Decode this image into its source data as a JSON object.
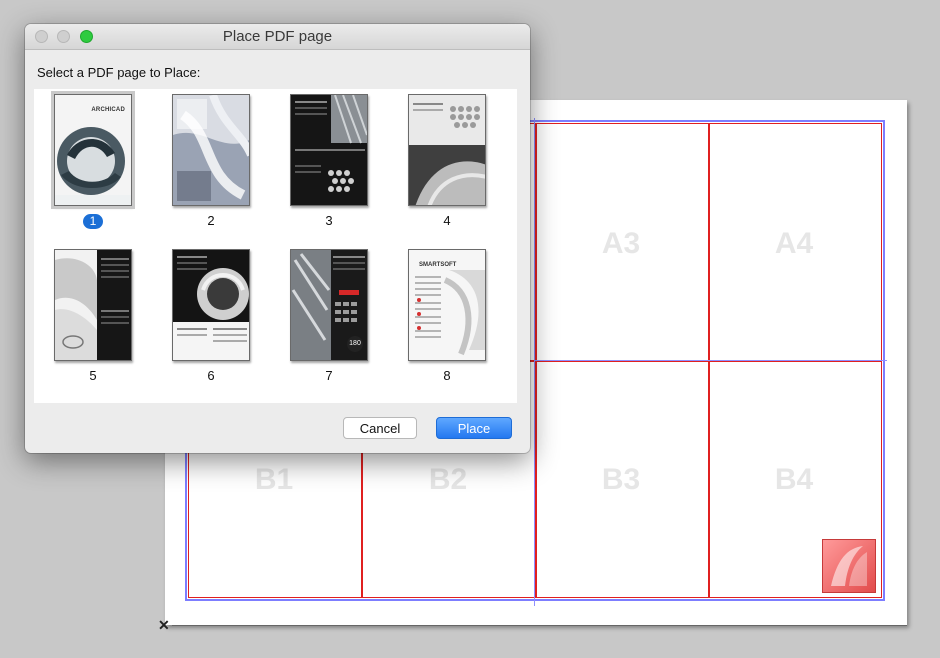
{
  "dialog": {
    "title": "Place PDF page",
    "prompt": "Select a PDF page to Place:",
    "selected_page": 1,
    "pages": [
      {
        "label": "1"
      },
      {
        "label": "2"
      },
      {
        "label": "3"
      },
      {
        "label": "4"
      },
      {
        "label": "5"
      },
      {
        "label": "6"
      },
      {
        "label": "7"
      },
      {
        "label": "8"
      }
    ],
    "page1_text": "ARCHICAD",
    "page7_badge": "180",
    "page8_text": "SMARTSOFT",
    "cancel_label": "Cancel",
    "place_label": "Place",
    "accent_color": "#2378f0"
  },
  "sheet": {
    "cells": [
      {
        "label": "A3"
      },
      {
        "label": "A4"
      },
      {
        "label": "B1"
      },
      {
        "label": "B2"
      },
      {
        "label": "B3"
      },
      {
        "label": "B4"
      }
    ],
    "frame_color": "#e02020",
    "guide_color": "#8f8fff",
    "close_glyph": "✕"
  }
}
